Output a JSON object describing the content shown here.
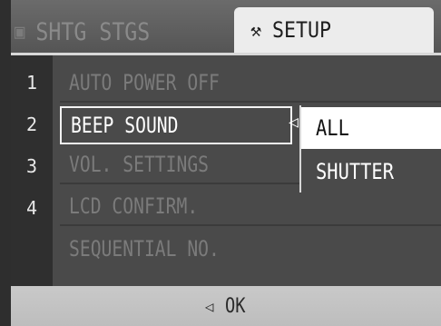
{
  "tabs": {
    "shooting": {
      "icon": "camera-icon",
      "label": "SHTG STGS"
    },
    "setup": {
      "icon": "wrench-icon",
      "label": "SETUP"
    }
  },
  "numbers": [
    "1",
    "2",
    "3",
    "4"
  ],
  "menu": {
    "items": [
      {
        "label": "AUTO POWER OFF"
      },
      {
        "label": "BEEP SOUND"
      },
      {
        "label": "VOL. SETTINGS"
      },
      {
        "label": "LCD CONFIRM."
      },
      {
        "label": "SEQUENTIAL NO."
      }
    ],
    "selected_index": 1
  },
  "popup": {
    "options": [
      "ALL",
      "SHUTTER"
    ],
    "selected": "ALL"
  },
  "footer": {
    "icon": "left-triangle-icon",
    "label": "OK"
  },
  "colors": {
    "background": "#3a3a3a",
    "tab_active": "#ececec",
    "highlight": "#ffffff",
    "footer": "#c4c4c4"
  }
}
